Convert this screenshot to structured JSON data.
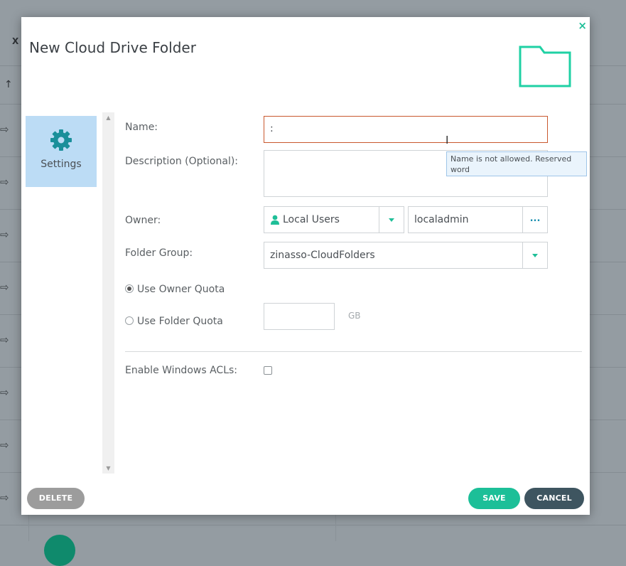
{
  "dialog": {
    "title": "New Cloud Drive Folder",
    "close_glyph": "×"
  },
  "side_tabs": [
    {
      "label": "Settings",
      "icon": "gear-icon",
      "active": true
    }
  ],
  "form": {
    "name_label": "Name:",
    "name_value": ":",
    "name_error_tooltip": "Name is not allowed. Reserved word",
    "description_label": "Description (Optional):",
    "description_value": "",
    "owner_label": "Owner:",
    "owner_type": "Local Users",
    "owner_name": "localadmin",
    "owner_more_glyph": "...",
    "folder_group_label": "Folder Group:",
    "folder_group_value": "zinasso-CloudFolders",
    "quota_owner_label": "Use Owner Quota",
    "quota_folder_label": "Use Folder Quota",
    "quota_selected": "owner",
    "quota_value": "",
    "quota_unit": "GB",
    "acl_label": "Enable Windows ACLs:",
    "acl_enabled": false
  },
  "buttons": {
    "delete": "DELETE",
    "save": "SAVE",
    "cancel": "CANCEL"
  },
  "background": {
    "excel_glyph": "X",
    "sort_glyph": "↑",
    "share_glyph": "⇨"
  },
  "colors": {
    "accent": "#1cbf98",
    "error_border": "#c9582e",
    "tab_active": "#bcdcf5",
    "cancel": "#3e5560",
    "delete": "#9c9c9c"
  }
}
